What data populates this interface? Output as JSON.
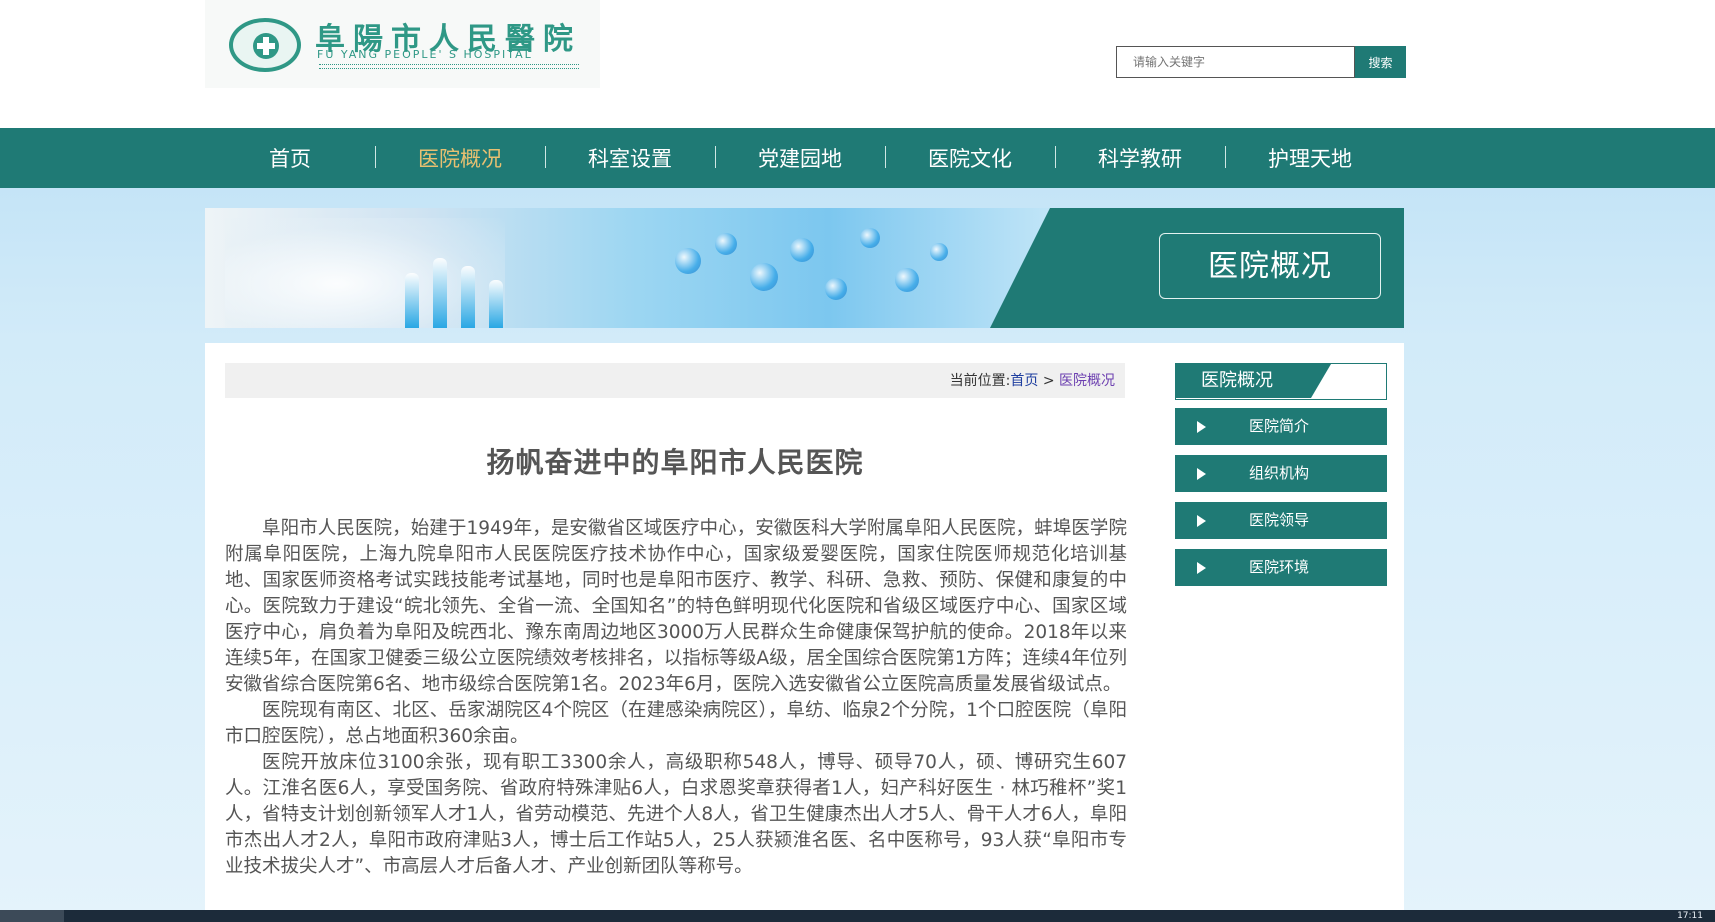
{
  "header": {
    "logo_cn": "阜陽市人民醫院",
    "logo_en": "FU YANG PEOPLE' S HOSPITAL",
    "search_placeholder": "请输入关键字",
    "search_button": "搜索"
  },
  "nav": {
    "items": [
      {
        "label": "首页",
        "active": false
      },
      {
        "label": "医院概况",
        "active": true
      },
      {
        "label": "科室设置",
        "active": false
      },
      {
        "label": "党建园地",
        "active": false
      },
      {
        "label": "医院文化",
        "active": false
      },
      {
        "label": "科学教研",
        "active": false
      },
      {
        "label": "护理天地",
        "active": false
      }
    ]
  },
  "banner": {
    "title": "医院概况"
  },
  "breadcrumb": {
    "prefix": "当前位置:",
    "home": "首页",
    "separator": ">",
    "current": "医院概况"
  },
  "article": {
    "title": "扬帆奋进中的阜阳市人民医院",
    "paragraphs": [
      "阜阳市人民医院，始建于1949年，是安徽省区域医疗中心，安徽医科大学附属阜阳人民医院，蚌埠医学院附属阜阳医院，上海九院阜阳市人民医院医疗技术协作中心，国家级爱婴医院，国家住院医师规范化培训基地、国家医师资格考试实践技能考试基地，同时也是阜阳市医疗、教学、科研、急救、预防、保健和康复的中心。医院致力于建设“皖北领先、全省一流、全国知名”的特色鲜明现代化医院和省级区域医疗中心、国家区域医疗中心，肩负着为阜阳及皖西北、豫东南周边地区3000万人民群众生命健康保驾护航的使命。2018年以来连续5年，在国家卫健委三级公立医院绩效考核排名，以指标等级A级，居全国综合医院第1方阵；连续4年位列安徽省综合医院第6名、地市级综合医院第1名。2023年6月，医院入选安徽省公立医院高质量发展省级试点。",
      "医院现有南区、北区、岳家湖院区4个院区（在建感染病院区），阜纺、临泉2个分院，1个口腔医院（阜阳市口腔医院），总占地面积360余亩。",
      "医院开放床位3100余张，现有职工3300余人，高级职称548人，博导、硕导70人，硕、博研究生607人。江淮名医6人，享受国务院、省政府特殊津贴6人，白求恩奖章获得者1人，妇产科好医生 · 林巧稚杯”奖1人，省特支计划创新领军人才1人，省劳动模范、先进个人8人，省卫生健康杰出人才5人、骨干人才6人，阜阳市杰出人才2人，阜阳市政府津贴3人，博士后工作站5人，25人获颍淮名医、名中医称号，93人获“阜阳市专业技术拔尖人才”、市高层人才后备人才、产业创新团队等称号。"
    ]
  },
  "sidebar": {
    "heading": "医院概况",
    "items": [
      {
        "label": "医院简介"
      },
      {
        "label": "组织机构"
      },
      {
        "label": "医院领导"
      },
      {
        "label": "医院环境"
      }
    ]
  },
  "taskbar": {
    "clock": "17:11"
  },
  "colors": {
    "primary": "#1f7a75",
    "nav_active": "#e8c071",
    "breadcrumb_link": "#1f3fa0",
    "breadcrumb_current": "#6c3fb0"
  }
}
